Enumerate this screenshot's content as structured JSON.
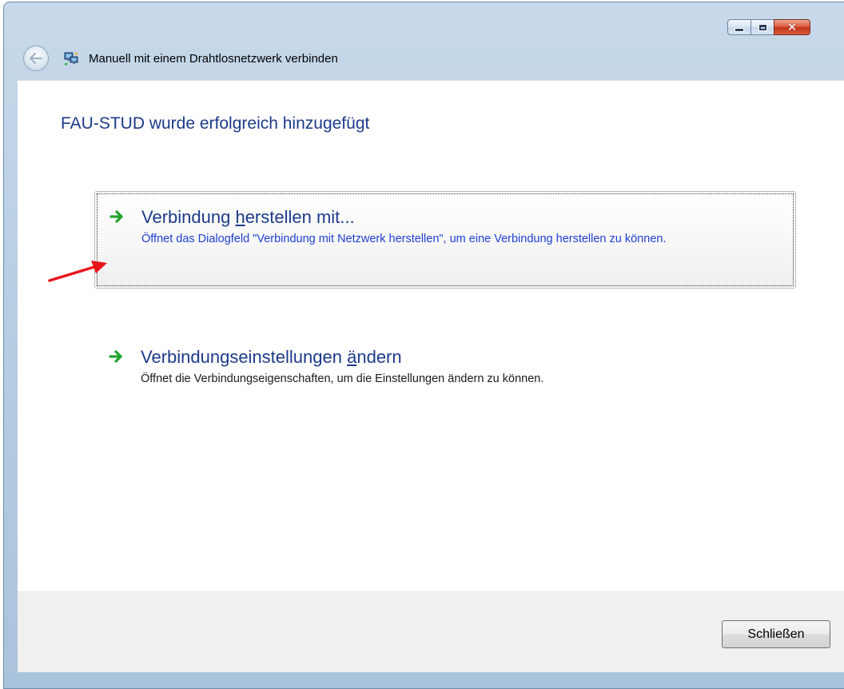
{
  "window": {
    "title": "Manuell mit einem Drahtlosnetzwerk verbinden",
    "caption_close_glyph": "✕"
  },
  "icons": {
    "back": "back-arrow-icon",
    "app": "network-connect-icon",
    "command_arrow": "green-arrow-icon",
    "annotation": "red-arrow-icon"
  },
  "main": {
    "headline": "FAU-STUD wurde erfolgreich hinzugefügt",
    "commands": [
      {
        "title_before": "Verbindung ",
        "title_access": "h",
        "title_after": "erstellen mit...",
        "description": "Öffnet das Dialogfeld \"Verbindung mit Netzwerk herstellen\", um eine Verbindung herstellen zu können."
      },
      {
        "title_before": "Verbindungseinstellungen ",
        "title_access": "ä",
        "title_after": "ndern",
        "description": "Öffnet die Verbindungseigenschaften, um die Einstellungen ändern zu können."
      }
    ]
  },
  "footer": {
    "close_label": "Schließen"
  },
  "colors": {
    "heading_blue": "#1c3a8a",
    "link_desc_blue": "#1f3fd1",
    "arrow_green": "#22a32a",
    "annotation_red": "#e8141b",
    "frame_blue": "#b9cfe4"
  }
}
